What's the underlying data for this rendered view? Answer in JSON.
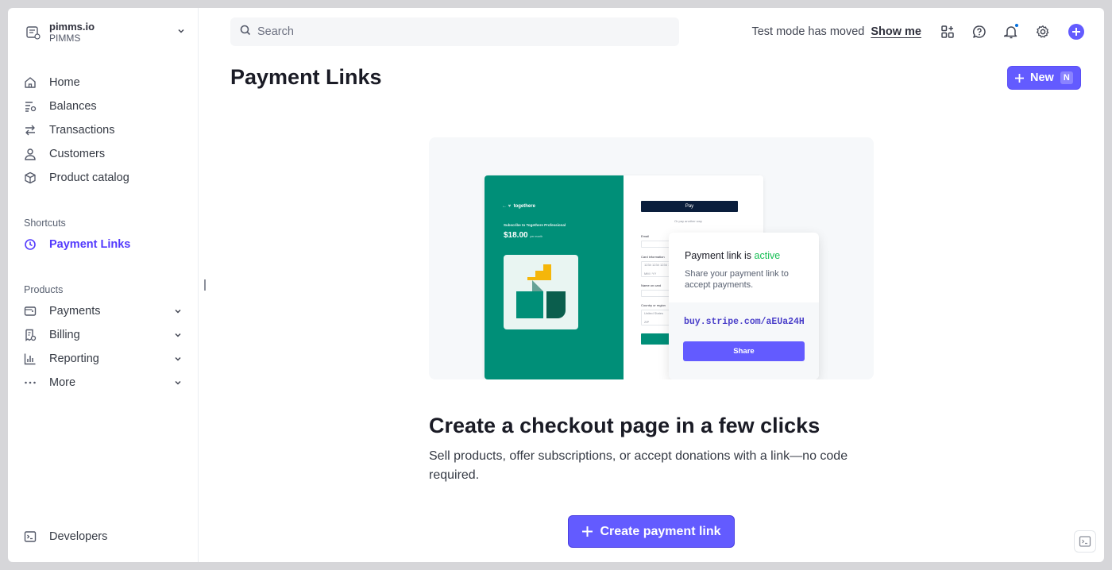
{
  "account": {
    "name": "pimms.io",
    "subtitle": "PIMMS"
  },
  "sidebar": {
    "items": [
      {
        "label": "Home",
        "icon": "home-icon"
      },
      {
        "label": "Balances",
        "icon": "balances-icon"
      },
      {
        "label": "Transactions",
        "icon": "transactions-icon"
      },
      {
        "label": "Customers",
        "icon": "customers-icon"
      },
      {
        "label": "Product catalog",
        "icon": "product-catalog-icon"
      }
    ],
    "shortcuts_label": "Shortcuts",
    "shortcuts": [
      {
        "label": "Payment Links",
        "icon": "clock-icon",
        "active": true
      }
    ],
    "products_label": "Products",
    "products": [
      {
        "label": "Payments",
        "icon": "payments-icon"
      },
      {
        "label": "Billing",
        "icon": "billing-icon"
      },
      {
        "label": "Reporting",
        "icon": "reporting-icon"
      },
      {
        "label": "More",
        "icon": "more-dots-icon"
      }
    ],
    "developers": {
      "label": "Developers",
      "icon": "terminal-icon"
    }
  },
  "search": {
    "placeholder": "Search"
  },
  "topbar": {
    "test_mode_text": "Test mode has moved",
    "show_me_label": "Show me",
    "icons": [
      "apps-icon",
      "help-icon",
      "notifications-icon",
      "settings-icon",
      "create-plus-icon"
    ]
  },
  "page": {
    "title": "Payment Links",
    "new_button": {
      "label": "New",
      "shortcut": "N"
    }
  },
  "illustration": {
    "checkout": {
      "brand": "togethere",
      "plan": "Subscribe to Togethere Professional",
      "price": "$18.00",
      "price_suffix": "per month",
      "apple_pay": "Pay",
      "or_text": "Or pay another way",
      "email_label": "Email",
      "card_label": "Card information",
      "card_number": "1234 1234 1234 1234",
      "card_expiry": "MM / YY",
      "name_label": "Name on card",
      "country_label": "Country or region",
      "country_value": "United States",
      "zip": "ZIP"
    },
    "share_card": {
      "title_prefix": "Payment link is ",
      "title_status": "active",
      "description": "Share your payment link to accept payments.",
      "url": "buy.stripe.com/aEUa24H",
      "share_label": "Share"
    }
  },
  "hero": {
    "title": "Create a checkout page in a few clicks",
    "description": "Sell products, offer subscriptions, or accept donations with a link—no code required.",
    "cta_label": "Create payment link"
  },
  "colors": {
    "accent": "#635bff",
    "active_green": "#15be53",
    "brand_teal": "#008f78"
  }
}
